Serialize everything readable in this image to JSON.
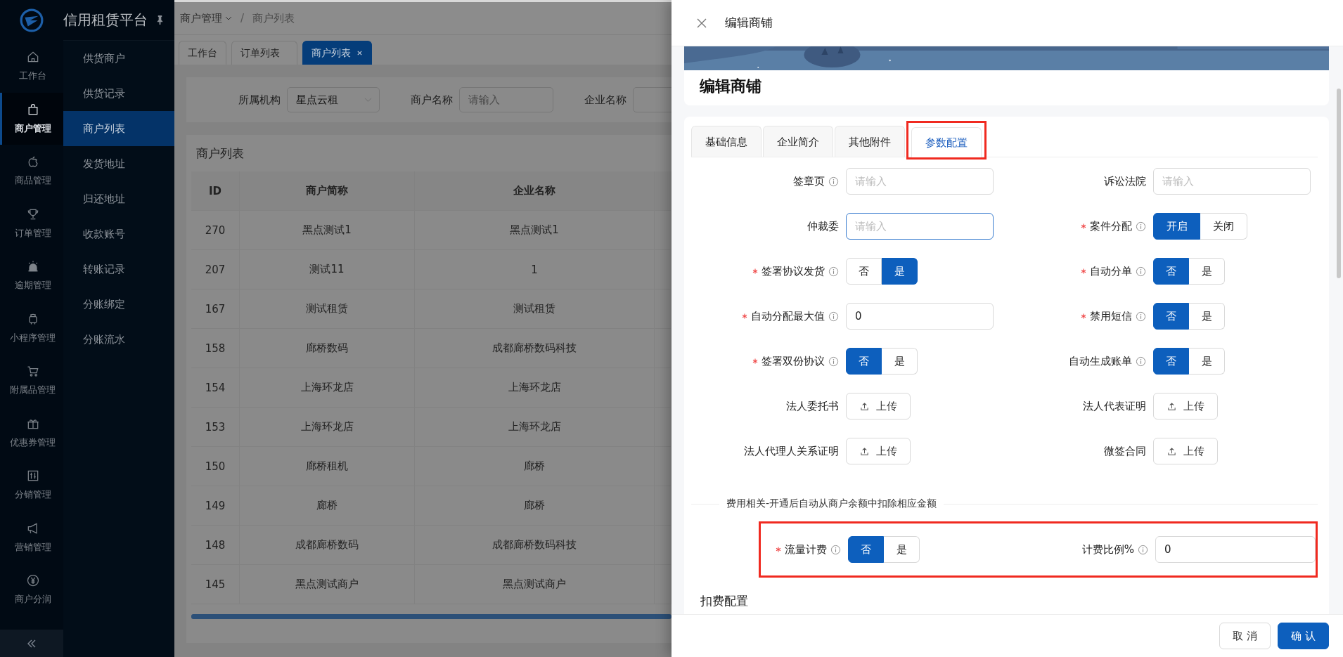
{
  "sidebar": {
    "brand": "信用租赁平台",
    "menu": [
      {
        "label": "工作台",
        "selected": false
      },
      {
        "label": "商户管理",
        "selected": true
      },
      {
        "label": "商品管理",
        "selected": false
      },
      {
        "label": "订单管理",
        "selected": false
      },
      {
        "label": "逾期管理",
        "selected": false
      },
      {
        "label": "小程序管理",
        "selected": false
      },
      {
        "label": "附属品管理",
        "selected": false
      },
      {
        "label": "优惠券管理",
        "selected": false
      },
      {
        "label": "分销管理",
        "selected": false
      },
      {
        "label": "营销管理",
        "selected": false
      },
      {
        "label": "商户分润",
        "selected": false
      }
    ],
    "submenu": [
      {
        "label": "供货商户",
        "selected": false
      },
      {
        "label": "供货记录",
        "selected": false
      },
      {
        "label": "商户列表",
        "selected": true
      },
      {
        "label": "发货地址",
        "selected": false
      },
      {
        "label": "归还地址",
        "selected": false
      },
      {
        "label": "收款账号",
        "selected": false
      },
      {
        "label": "转账记录",
        "selected": false
      },
      {
        "label": "分账绑定",
        "selected": false
      },
      {
        "label": "分账流水",
        "selected": false
      }
    ]
  },
  "breadcrumb": [
    "商户管理",
    "商户列表"
  ],
  "breadcrumb_separator": "/",
  "page_tabs": [
    {
      "label": "工作台",
      "selected": false,
      "closable": false
    },
    {
      "label": "订单列表",
      "selected": false,
      "closable": false
    },
    {
      "label": "商户列表",
      "selected": true,
      "closable": true
    }
  ],
  "filters": [
    {
      "label": "所属机构",
      "kind": "select",
      "value": "星点云租"
    },
    {
      "label": "商户名称",
      "kind": "input",
      "placeholder": "请输入"
    },
    {
      "label": "企业名称",
      "kind": "input"
    }
  ],
  "list": {
    "title": "商户列表",
    "columns": [
      "ID",
      "商户简称",
      "企业名称"
    ],
    "rows": [
      [
        "270",
        "黑点测试1",
        "黑点测试1"
      ],
      [
        "207",
        "测试11",
        "1"
      ],
      [
        "167",
        "测试租赁",
        "测试租赁"
      ],
      [
        "158",
        "廊桥数码",
        "成都廊桥数码科技"
      ],
      [
        "154",
        "上海环龙店",
        "上海环龙店"
      ],
      [
        "153",
        "上海环龙店",
        "上海环龙店"
      ],
      [
        "150",
        "廊桥租机",
        "廊桥"
      ],
      [
        "149",
        "廊桥",
        "廊桥"
      ],
      [
        "148",
        "成都廊桥数码",
        "成都廊桥数码科技"
      ],
      [
        "145",
        "黑点测试商户",
        "黑点测试商户"
      ]
    ]
  },
  "drawer": {
    "title": "编辑商铺",
    "card_title": "编辑商铺",
    "tabs": [
      {
        "label": "基础信息",
        "selected": false,
        "highlighted": false
      },
      {
        "label": "企业简介",
        "selected": false,
        "highlighted": false
      },
      {
        "label": "其他附件",
        "selected": false,
        "highlighted": false
      },
      {
        "label": "参数配置",
        "selected": true,
        "highlighted": true
      }
    ],
    "fields": [
      {
        "label": "签章页",
        "required": false,
        "info": true,
        "kind": "input",
        "placeholder": "请输入",
        "focused": false
      },
      {
        "label": "诉讼法院",
        "required": false,
        "info": false,
        "kind": "input",
        "placeholder": "请输入",
        "focused": false
      },
      {
        "label": "仲裁委",
        "required": false,
        "info": false,
        "kind": "input",
        "placeholder": "请输入",
        "focused": true
      },
      {
        "label": "案件分配",
        "required": true,
        "info": true,
        "kind": "toggle",
        "options": [
          {
            "label": "开启",
            "selected": true
          },
          {
            "label": "关闭",
            "selected": false
          }
        ]
      },
      {
        "label": "签署协议发货",
        "required": true,
        "info": true,
        "kind": "toggle",
        "options": [
          {
            "label": "否",
            "selected": false
          },
          {
            "label": "是",
            "selected": true
          }
        ]
      },
      {
        "label": "自动分单",
        "required": true,
        "info": true,
        "kind": "toggle",
        "options": [
          {
            "label": "否",
            "selected": true
          },
          {
            "label": "是",
            "selected": false
          }
        ]
      },
      {
        "label": "自动分配最大值",
        "required": true,
        "info": true,
        "kind": "input",
        "value": "0",
        "focused": false
      },
      {
        "label": "禁用短信",
        "required": true,
        "info": true,
        "kind": "toggle",
        "options": [
          {
            "label": "否",
            "selected": true
          },
          {
            "label": "是",
            "selected": false
          }
        ]
      },
      {
        "label": "签署双份协议",
        "required": true,
        "info": true,
        "kind": "toggle",
        "options": [
          {
            "label": "否",
            "selected": true
          },
          {
            "label": "是",
            "selected": false
          }
        ]
      },
      {
        "label": "自动生成账单",
        "required": false,
        "info": true,
        "kind": "toggle",
        "options": [
          {
            "label": "否",
            "selected": true
          },
          {
            "label": "是",
            "selected": false
          }
        ]
      },
      {
        "label": "法人委托书",
        "required": false,
        "info": false,
        "kind": "upload",
        "button": "上传"
      },
      {
        "label": "法人代表证明",
        "required": false,
        "info": false,
        "kind": "upload",
        "button": "上传"
      },
      {
        "label": "法人代理人关系证明",
        "required": false,
        "info": false,
        "kind": "upload",
        "button": "上传"
      },
      {
        "label": "微签合同",
        "required": false,
        "info": false,
        "kind": "upload",
        "button": "上传"
      }
    ],
    "fee_section": {
      "title": "费用相关-开通后自动从商户余额中扣除相应金额",
      "highlighted": true,
      "fields": [
        {
          "label": "流量计费",
          "required": true,
          "info": true,
          "kind": "toggle",
          "options": [
            {
              "label": "否",
              "selected": true
            },
            {
              "label": "是",
              "selected": false
            }
          ]
        },
        {
          "label": "计费比例%",
          "required": false,
          "info": true,
          "kind": "input",
          "value": "0",
          "focused": false
        }
      ]
    },
    "deduction_title": "扣费配置",
    "buttons": [
      {
        "label": "取 消",
        "kind": "default"
      },
      {
        "label": "确 认",
        "kind": "primary"
      }
    ]
  }
}
